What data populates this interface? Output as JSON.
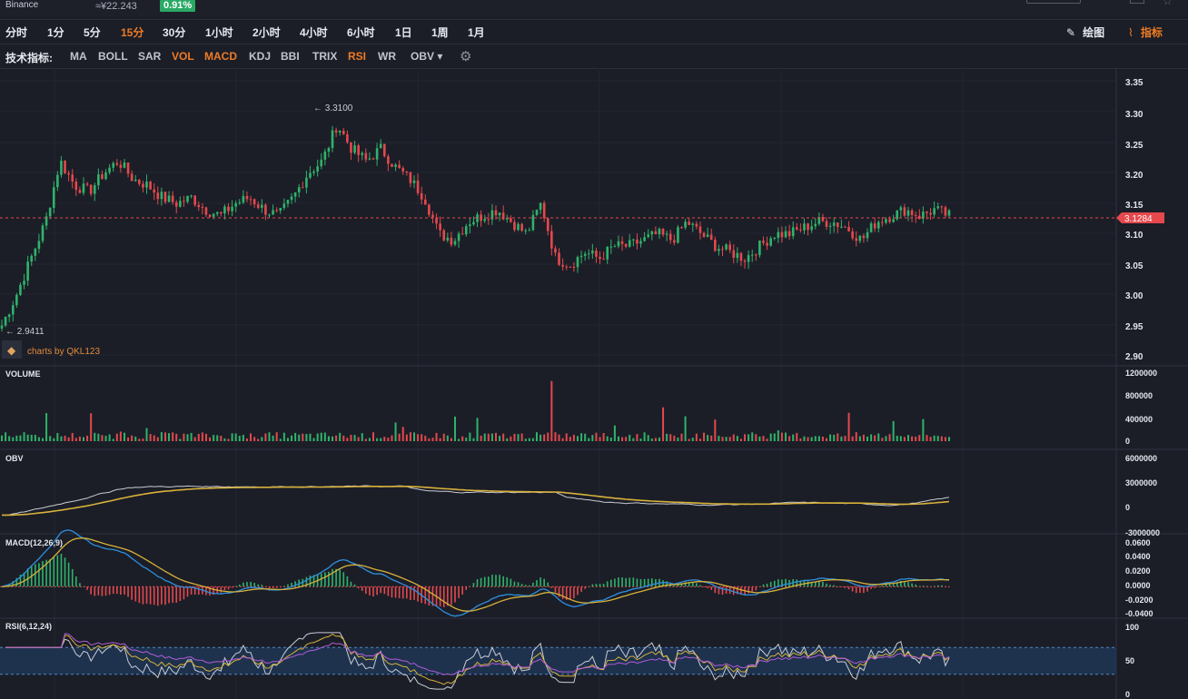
{
  "header": {
    "exchange": "Binance",
    "price_cny": "≈¥22.243",
    "change": "0.91%"
  },
  "timeframes": [
    {
      "label": "分时",
      "active": false
    },
    {
      "label": "1分",
      "active": false
    },
    {
      "label": "5分",
      "active": false
    },
    {
      "label": "15分",
      "active": true
    },
    {
      "label": "30分",
      "active": false
    },
    {
      "label": "1小时",
      "active": false
    },
    {
      "label": "2小时",
      "active": false
    },
    {
      "label": "4小时",
      "active": false
    },
    {
      "label": "6小时",
      "active": false
    },
    {
      "label": "1日",
      "active": false
    },
    {
      "label": "1周",
      "active": false
    },
    {
      "label": "1月",
      "active": false
    }
  ],
  "tools": {
    "draw_label": "绘图",
    "indicator_label": "指标"
  },
  "indicators": {
    "label": "技术指标:",
    "items": [
      {
        "label": "MA",
        "on": false
      },
      {
        "label": "BOLL",
        "on": false
      },
      {
        "label": "SAR",
        "on": false
      },
      {
        "label": "VOL",
        "on": true
      },
      {
        "label": "MACD",
        "on": true
      },
      {
        "label": "KDJ",
        "on": false
      },
      {
        "label": "BBI",
        "on": false
      },
      {
        "label": "TRIX",
        "on": false
      },
      {
        "label": "RSI",
        "on": true
      },
      {
        "label": "WR",
        "on": false
      },
      {
        "label": "OBV ▾",
        "on": false
      }
    ]
  },
  "chart": {
    "watermark": "charts by QKL123",
    "high_marker": "← 3.3100",
    "low_marker": "← 2.9411",
    "last_price": "3.1284",
    "price_ticks": [
      "3.35",
      "3.30",
      "3.25",
      "3.20",
      "3.15",
      "3.10",
      "3.05",
      "3.00",
      "2.95",
      "2.90"
    ],
    "volume": {
      "title": "VOLUME",
      "ticks": [
        "1200000",
        "800000",
        "400000",
        "0"
      ]
    },
    "obv": {
      "title": "OBV",
      "ticks": [
        "6000000",
        "3000000",
        "0",
        "-3000000"
      ]
    },
    "macd": {
      "title": "MACD(12,26,9)",
      "ticks": [
        "0.0600",
        "0.0400",
        "0.0200",
        "0.0000",
        "-0.0200",
        "-0.0400"
      ]
    },
    "rsi": {
      "title": "RSI(6,12,24)",
      "ticks": [
        "100",
        "50",
        "0"
      ]
    },
    "colors": {
      "up": "#2fb36b",
      "down": "#e5484d",
      "yellow": "#d8b13a",
      "blue": "#2f8fe0",
      "white": "#c9ccd4",
      "accent": "#f07b24"
    }
  },
  "chart_data": {
    "type": "candlestick",
    "y_range": [
      2.9,
      3.35
    ],
    "high": 3.31,
    "low": 2.9411,
    "last": 3.1284,
    "close_series": [
      2.95,
      3.0,
      3.06,
      3.12,
      3.22,
      3.18,
      3.17,
      3.2,
      3.22,
      3.19,
      3.18,
      3.16,
      3.15,
      3.16,
      3.14,
      3.13,
      3.15,
      3.16,
      3.14,
      3.13,
      3.16,
      3.2,
      3.22,
      3.28,
      3.24,
      3.22,
      3.24,
      3.21,
      3.19,
      3.16,
      3.1,
      3.09,
      3.12,
      3.13,
      3.14,
      3.12,
      3.1,
      3.15,
      3.06,
      3.05,
      3.07,
      3.06,
      3.08,
      3.08,
      3.09,
      3.1,
      3.09,
      3.12,
      3.1,
      3.08,
      3.07,
      3.06,
      3.08,
      3.1,
      3.1,
      3.11,
      3.12,
      3.12,
      3.11,
      3.09,
      3.12,
      3.13,
      3.14,
      3.13,
      3.14,
      3.13
    ],
    "volume_ticks": [
      0,
      400000,
      800000,
      1200000
    ],
    "obv_range": [
      -3000000,
      6000000
    ],
    "macd_range": [
      -0.04,
      0.06
    ],
    "rsi_range": [
      0,
      100
    ]
  }
}
